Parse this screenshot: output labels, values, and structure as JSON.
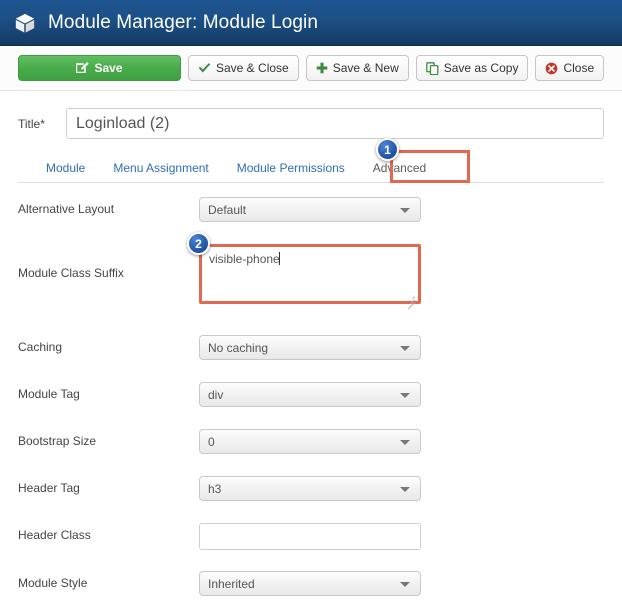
{
  "header": {
    "icon": "cube-icon",
    "title": "Module Manager: Module Login",
    "bg_color": "#1c4f85"
  },
  "toolbar": {
    "buttons": [
      {
        "label": "Save",
        "icon": "edit-pencil-icon",
        "style": "primary",
        "color": "#4aab4c"
      },
      {
        "label": "Save & Close",
        "icon": "check-icon",
        "style": "default",
        "color": "#3d8b40"
      },
      {
        "label": "Save & New",
        "icon": "plus-icon",
        "style": "default",
        "color": "#3d8b40"
      },
      {
        "label": "Save as Copy",
        "icon": "copy-icon",
        "style": "default",
        "color": "#3d8b40"
      },
      {
        "label": "Close",
        "icon": "close-circle-icon",
        "style": "default",
        "color": "#c0392b"
      }
    ]
  },
  "title_field": {
    "label": "Title",
    "required_mark": "*",
    "value": "Loginload (2)",
    "placeholder": ""
  },
  "tabs": {
    "items": [
      {
        "label": "Module",
        "active": false
      },
      {
        "label": "Menu Assignment",
        "active": false
      },
      {
        "label": "Module Permissions",
        "active": false
      },
      {
        "label": "Advanced",
        "active": true
      }
    ]
  },
  "annotations": {
    "highlight_color": "#e2694f",
    "badges": [
      {
        "number": "1",
        "target": "Advanced tab"
      },
      {
        "number": "2",
        "target": "Module Class Suffix field"
      }
    ]
  },
  "form": {
    "fields": [
      {
        "label": "Alternative Layout",
        "type": "select",
        "value": "Default",
        "highlighted": false
      },
      {
        "label": "Module Class Suffix",
        "type": "textarea",
        "value": "visible-phone",
        "highlighted": true
      },
      {
        "label": "Caching",
        "type": "select",
        "value": "No caching",
        "highlighted": false
      },
      {
        "label": "Module Tag",
        "type": "select",
        "value": "div",
        "highlighted": false
      },
      {
        "label": "Bootstrap Size",
        "type": "select",
        "value": "0",
        "highlighted": false
      },
      {
        "label": "Header Tag",
        "type": "select",
        "value": "h3",
        "highlighted": false
      },
      {
        "label": "Header Class",
        "type": "text",
        "value": "",
        "highlighted": false
      },
      {
        "label": "Module Style",
        "type": "select",
        "value": "Inherited",
        "highlighted": false
      }
    ]
  }
}
